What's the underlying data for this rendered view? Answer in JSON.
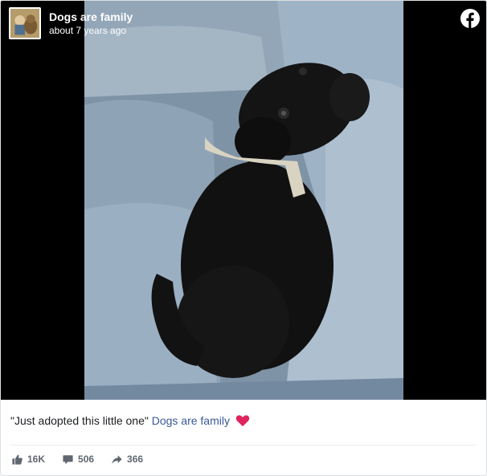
{
  "post": {
    "page_name": "Dogs are family",
    "timestamp": "about 7 years ago",
    "caption_text": "\"Just adopted this little one\"",
    "caption_link": "Dogs are family",
    "stats": {
      "likes": "16K",
      "comments": "506",
      "shares": "366"
    }
  },
  "icons": {
    "logo": "facebook-icon",
    "heart": "heart-icon",
    "like": "thumbs-up-icon",
    "comment": "comment-icon",
    "share": "share-arrow-icon"
  },
  "colors": {
    "link": "#385898",
    "heart": "#e0245e",
    "muted": "#606770"
  }
}
